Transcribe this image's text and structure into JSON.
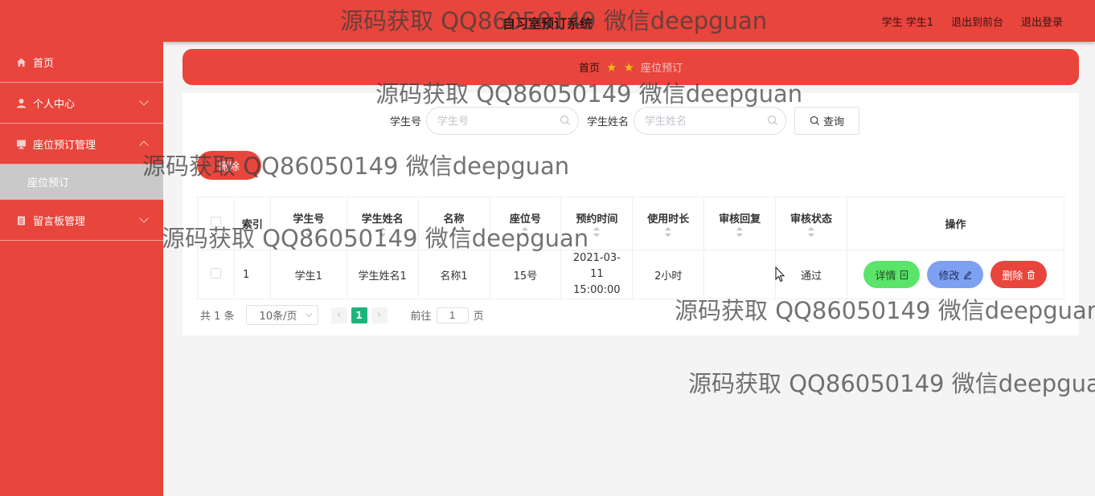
{
  "header": {
    "title": "自习室预订系统",
    "user": "学生 学生1",
    "to_front": "退出到前台",
    "logout": "退出登录"
  },
  "sidebar": {
    "items": [
      {
        "label": "首页",
        "icon": "home-icon"
      },
      {
        "label": "个人中心",
        "icon": "user-icon"
      },
      {
        "label": "座位预订管理",
        "icon": "monitor-icon"
      },
      {
        "label": "座位预订",
        "icon": ""
      },
      {
        "label": "留言板管理",
        "icon": "clipboard-icon"
      }
    ]
  },
  "breadcrumb": {
    "home": "首页",
    "current": "座位预订"
  },
  "search": {
    "student_no_label": "学生号",
    "student_no_placeholder": "学生号",
    "student_name_label": "学生姓名",
    "student_name_placeholder": "学生姓名",
    "query_button": "查询"
  },
  "batch_delete": "删除",
  "table": {
    "columns": [
      "",
      "索引",
      "学生号",
      "学生姓名",
      "名称",
      "座位号",
      "预约时间",
      "使用时长",
      "审核回复",
      "审核状态",
      "操作"
    ],
    "rows": [
      {
        "index": "1",
        "student_no": "学生1",
        "student_name": "学生姓名1",
        "name": "名称1",
        "seat": "15号",
        "time": "2021-03-11 15:00:00",
        "duration": "2小时",
        "reply": "",
        "status": "通过"
      }
    ],
    "actions": {
      "detail": "详情",
      "edit": "修改",
      "delete": "删除"
    }
  },
  "pagination": {
    "total": "共 1 条",
    "page_size": "10条/页",
    "current_page": "1",
    "goto_prefix": "前往",
    "goto_value": "1",
    "goto_suffix": "页"
  },
  "watermark": "源码获取 QQ86050149 微信deepguan",
  "colors": {
    "primary": "#e8453c",
    "detail": "#5be36a",
    "edit": "#7ea0f0",
    "page_active": "#1bb57c"
  }
}
